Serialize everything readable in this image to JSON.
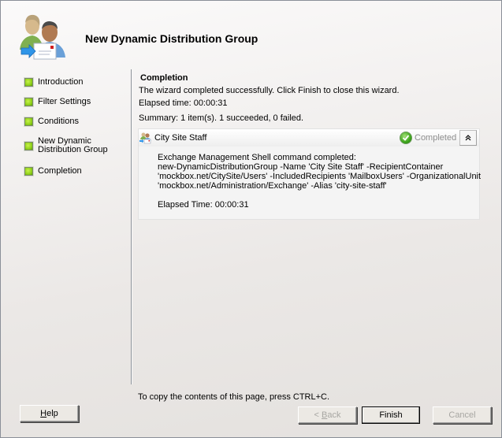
{
  "window": {
    "title": "New Dynamic Distribution Group",
    "header_icon": "dynamic-distribution-group-icon"
  },
  "nav": {
    "items": [
      {
        "label": "Introduction",
        "icon": "green-status-bullet"
      },
      {
        "label": "Filter Settings",
        "icon": "green-status-bullet"
      },
      {
        "label": "Conditions",
        "icon": "green-status-bullet"
      },
      {
        "label_line1": "New Dynamic",
        "label_line2": "Distribution Group",
        "icon": "green-status-bullet"
      },
      {
        "label": "Completion",
        "icon": "green-status-bullet"
      }
    ]
  },
  "content": {
    "title": "Completion",
    "message": "The wizard completed successfully. Click Finish to close this wizard.",
    "elapsed": "Elapsed time: 00:00:31",
    "summary": "Summary: 1 item(s). 1 succeeded, 0 failed.",
    "result": {
      "item_name": "City Site Staff",
      "item_icon": "distribution-group-icon",
      "status": "Completed",
      "status_icon": "green-check-icon",
      "collapse_icon": "double-chevron-up-icon",
      "body_lines": [
        "Exchange Management Shell command completed:",
        "new-DynamicDistributionGroup -Name 'City Site Staff' -RecipientContainer",
        "'mockbox.net/CitySite/Users' -IncludedRecipients 'MailboxUsers' -OrganizationalUnit",
        "'mockbox.net/Administration/Exchange' -Alias 'city-site-staff'"
      ],
      "elapsed": "Elapsed Time: 00:00:31"
    },
    "copy_hint": "To copy the contents of this page, press CTRL+C."
  },
  "buttons": {
    "help": {
      "mnemonic": "H",
      "rest": "elp",
      "enabled": true
    },
    "back": {
      "prefix": "< ",
      "mnemonic": "B",
      "rest": "ack",
      "enabled": false
    },
    "finish": {
      "label": "Finish",
      "enabled": true,
      "default": true
    },
    "cancel": {
      "label": "Cancel",
      "enabled": false
    }
  }
}
